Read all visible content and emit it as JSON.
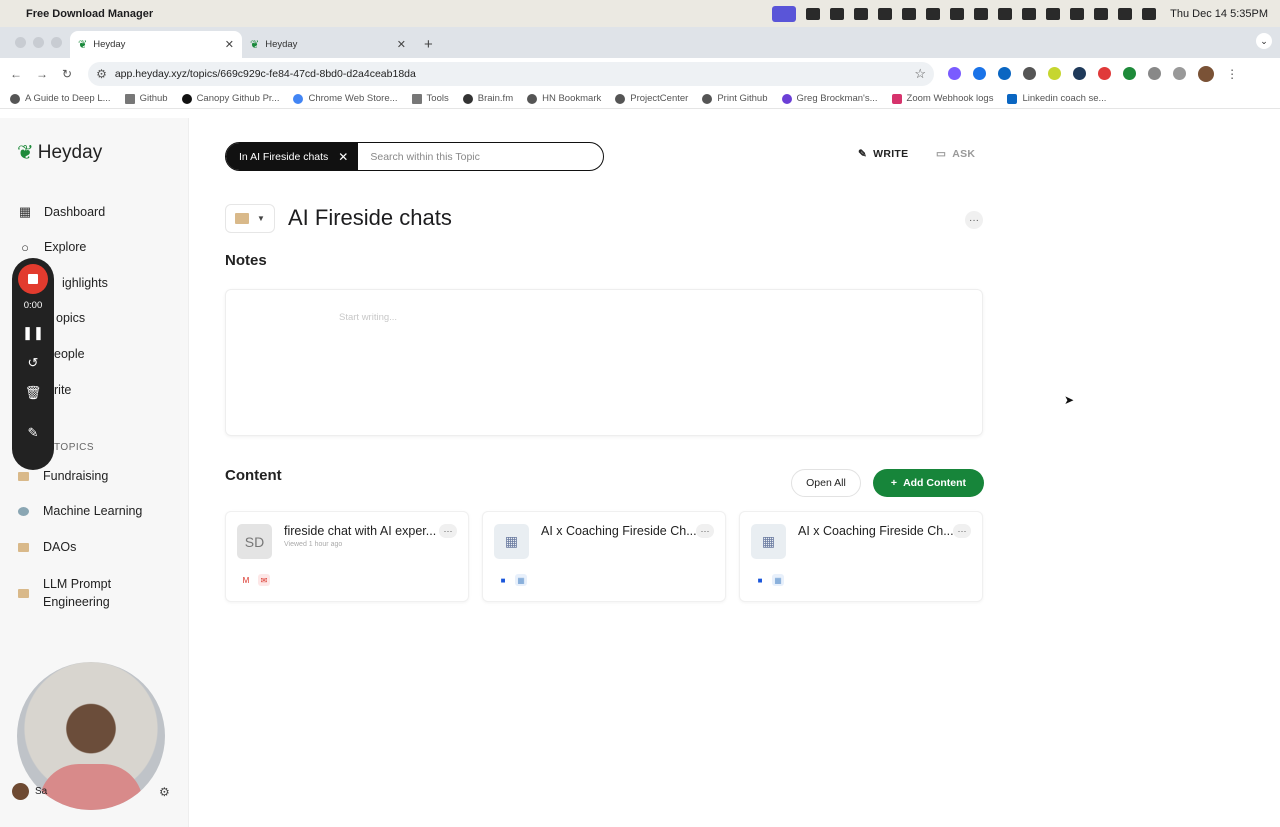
{
  "menubar": {
    "app_name": "Free Download Manager",
    "clock": "Thu Dec 14  5:35PM"
  },
  "browser": {
    "tabs": [
      {
        "label": "Heyday",
        "active": true
      },
      {
        "label": "Heyday",
        "active": false
      }
    ],
    "url": "app.heyday.xyz/topics/669c929c-fe84-47cd-8bd0-d2a4ceab18da",
    "bookmarks": [
      "A Guide to Deep L...",
      "Github",
      "Canopy Github Pr...",
      "Chrome Web Store...",
      "Tools",
      "Brain.fm",
      "HN Bookmark",
      "ProjectCenter",
      "Print Github",
      "Greg Brockman's...",
      "Zoom Webhook logs",
      "Linkedin coach se..."
    ]
  },
  "sidebar": {
    "logo": "Heyday",
    "nav": [
      {
        "label": "Dashboard",
        "icon": "grid-icon"
      },
      {
        "label": "Explore",
        "icon": "search-icon"
      },
      {
        "label": "ighlights",
        "icon": "highlight-icon"
      },
      {
        "label": "opics",
        "icon": "folder-icon"
      },
      {
        "label": "eople",
        "icon": "people-icon"
      },
      {
        "label": "rite",
        "icon": "pen-icon"
      }
    ],
    "topics_label": "TOPICS",
    "topics": [
      "Fundraising",
      "Machine Learning",
      "DAOs",
      "LLM Prompt Engineering"
    ],
    "user_label": "Sa"
  },
  "recorder": {
    "time": "0:00"
  },
  "main": {
    "scope_pill": "In AI Fireside chats",
    "search_placeholder": "Search within this Topic",
    "write_label": "WRITE",
    "ask_label": "ASK",
    "title": "AI Fireside chats",
    "notes_heading": "Notes",
    "notes_placeholder": "Start writing...",
    "content_heading": "Content",
    "open_all_label": "Open All",
    "add_content_label": "Add Content",
    "cards": [
      {
        "thumb": "SD",
        "title": "fireside chat with AI exper...",
        "subtitle": "Viewed 1 hour ago"
      },
      {
        "thumb": "",
        "title": "AI x Coaching Fireside Ch...",
        "subtitle": ""
      },
      {
        "thumb": "",
        "title": "AI x Coaching Fireside Ch...",
        "subtitle": ""
      }
    ]
  },
  "colors": {
    "brand_green": "#17853a",
    "record_red": "#e23b2e"
  }
}
